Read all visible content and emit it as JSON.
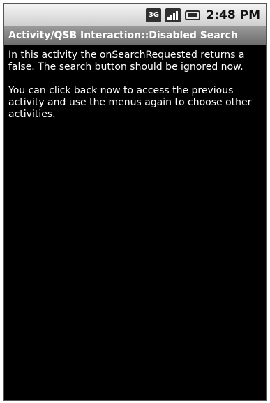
{
  "status_bar": {
    "network_label": "3G",
    "time": "2:48 PM",
    "icons": [
      "network-3g-icon",
      "signal-icon",
      "battery-icon"
    ]
  },
  "activity": {
    "title": "Activity/QSB Interaction::Disabled Search"
  },
  "content": {
    "paragraph1": "In this activity the onSearchRequested returns a false. The search button should be ignored now.",
    "paragraph2": "You can click back now to access the previous activity and use the menus again to choose other activities."
  },
  "colors": {
    "background": "#000000",
    "text": "#ffffff",
    "title_bar": "#7d7d7d",
    "status_bar": "#dcdcdc"
  }
}
